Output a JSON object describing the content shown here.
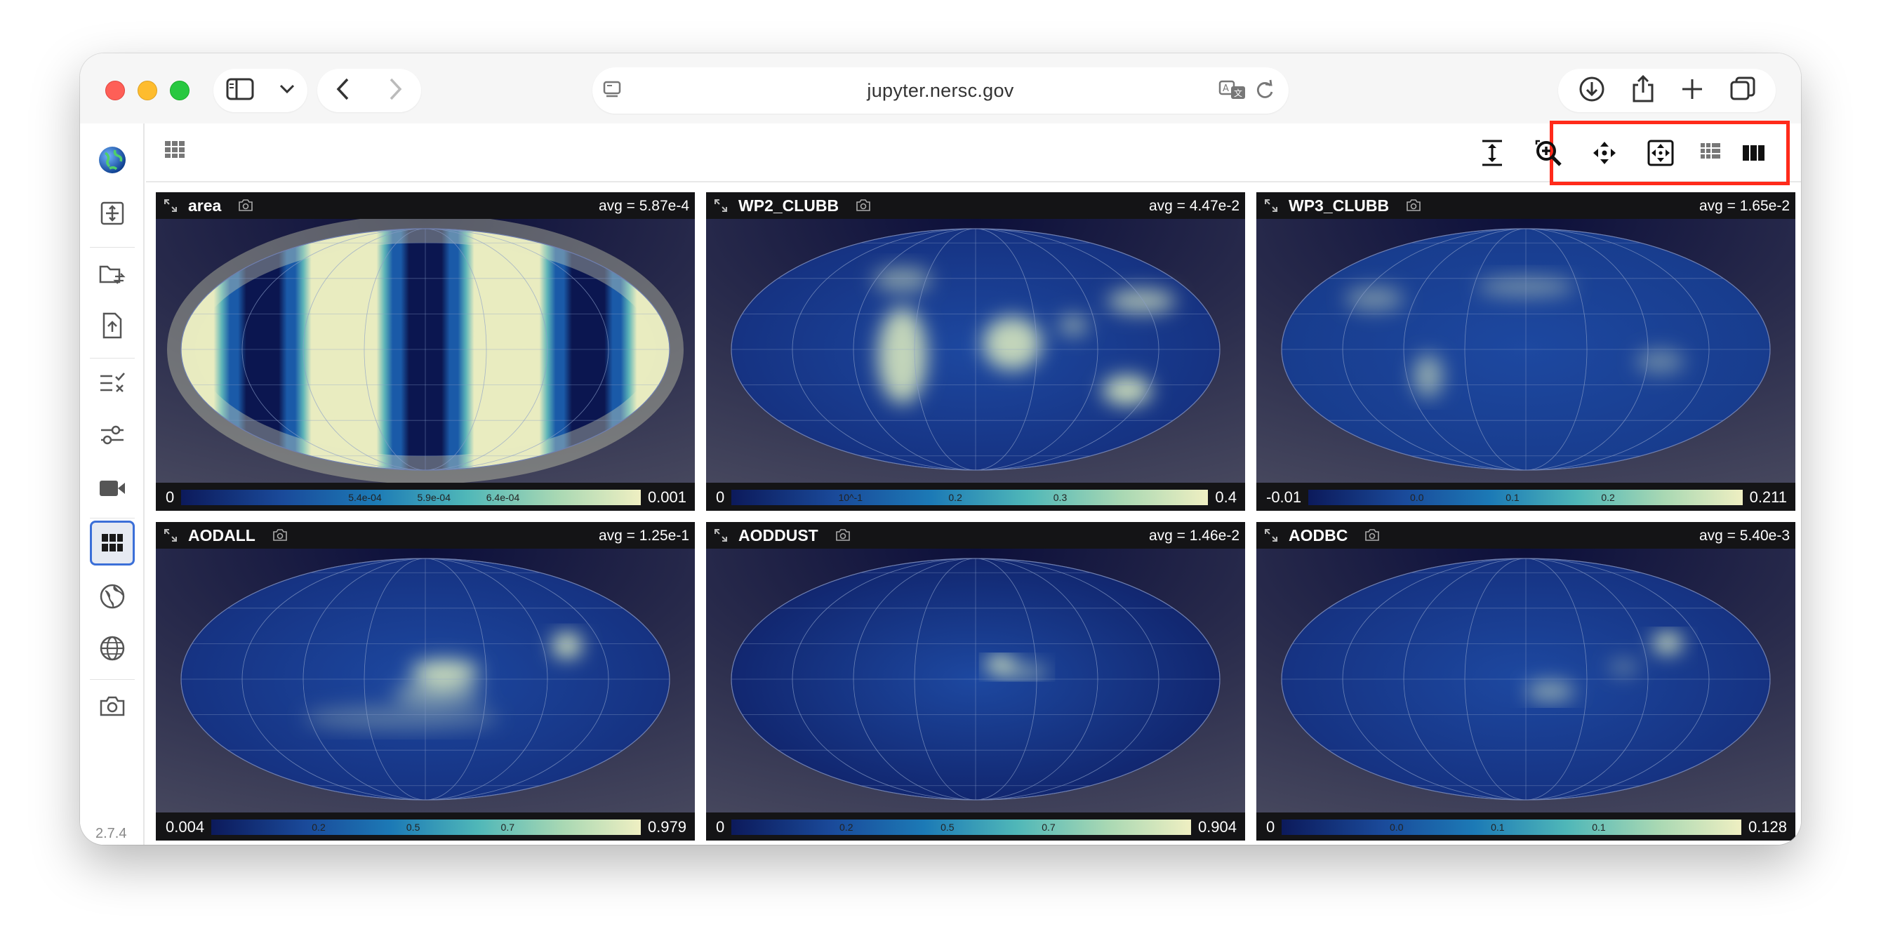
{
  "browser": {
    "url": "jupyter.nersc.gov"
  },
  "app": {
    "version": "2.7.4"
  },
  "panels": [
    {
      "title": "area",
      "avg": "avg = 5.87e-4",
      "min": "0",
      "max": "0.001",
      "ticks": [
        "5.4e-04",
        "5.9e-04",
        "6.4e-04"
      ],
      "pattern": "bands"
    },
    {
      "title": "WP2_CLUBB",
      "avg": "avg = 4.47e-2",
      "min": "0",
      "max": "0.4",
      "ticks": [
        "10^-1",
        "0.2",
        "0.3"
      ],
      "pattern": "wp2"
    },
    {
      "title": "WP3_CLUBB",
      "avg": "avg = 1.65e-2",
      "min": "-0.01",
      "max": "0.211",
      "ticks": [
        "0.0",
        "0.1",
        "0.2"
      ],
      "pattern": "wp3"
    },
    {
      "title": "AODALL",
      "avg": "avg = 1.25e-1",
      "min": "0.004",
      "max": "0.979",
      "ticks": [
        "0.2",
        "0.5",
        "0.7"
      ],
      "pattern": "aodall"
    },
    {
      "title": "AODDUST",
      "avg": "avg = 1.46e-2",
      "min": "0",
      "max": "0.904",
      "ticks": [
        "0.2",
        "0.5",
        "0.7"
      ],
      "pattern": "aoddust"
    },
    {
      "title": "AODBC",
      "avg": "avg = 5.40e-3",
      "min": "0",
      "max": "0.128",
      "ticks": [
        "0.0",
        "0.1",
        "0.1"
      ],
      "pattern": "aodbc"
    }
  ],
  "colors": {
    "highlight": "#ff2a1a",
    "panel_header": "#141416",
    "panel_bg": "#46475c",
    "active_tab": "#3b6fd8"
  },
  "icons": {
    "sidebar": [
      "globe-logo-icon",
      "move-grid-icon",
      "folder-swap-icon",
      "file-upload-icon",
      "checklist-icon",
      "sliders-icon",
      "video-camera-icon",
      "grid-view-icon",
      "globe-icon",
      "wireframe-globe-icon",
      "camera-icon"
    ],
    "toolbar": [
      "fit-height-icon",
      "zoom-in-icon",
      "pan-arrows-icon",
      "reset-view-icon",
      "grid-small-icon",
      "columns-icon"
    ]
  }
}
